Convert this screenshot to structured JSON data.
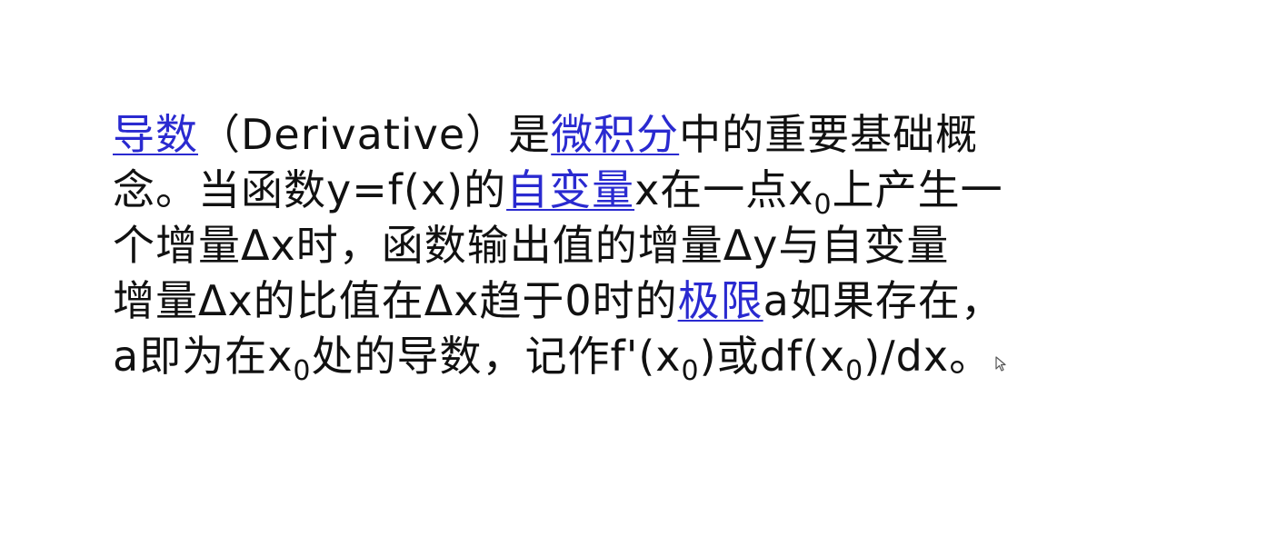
{
  "paragraph": {
    "l1": {
      "link_derivative": "导数",
      "t1": "（Derivative）是",
      "link_calculus": "微积分",
      "t2": "中的重要基础概"
    },
    "l2": {
      "t1": "念。当函数y=f(x)的",
      "link_independent_var": "自变量",
      "t2": "x在一点x",
      "sub1": "0",
      "t3": "上产生一"
    },
    "l3": {
      "t1": "个增量Δx时，函数输出值的增量Δy与自变量"
    },
    "l4": {
      "t1": "增量Δx的比值在Δx趋于0时的",
      "link_limit": "极限",
      "t2": "a如果存在，"
    },
    "l5": {
      "t1": "a即为在x",
      "sub1": "0",
      "t2": "处的导数，记作f'(x",
      "sub2": "0",
      "t3": ")或df(x",
      "sub3": "0",
      "t4": ")/dx",
      "t5": "。"
    }
  },
  "colors": {
    "link": "#2a2ad0",
    "text": "#111111",
    "background": "#ffffff"
  },
  "icons": {
    "cursor": "mouse-pointer-icon"
  }
}
